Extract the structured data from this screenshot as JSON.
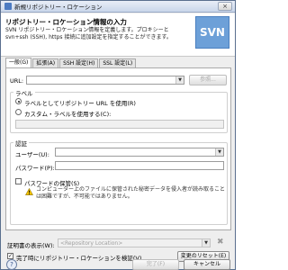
{
  "window": {
    "title": "新規リポジトリー・ロケーション",
    "close_glyph": "×"
  },
  "header": {
    "title": "リポジトリー・ロケーション情報の入力",
    "description": "SVN リポジトリー・ロケーション情報を定義します。プロキシーと svn+ssh (SSH), https 接続に追加設定を指定することができます。",
    "logo_text": "SVN"
  },
  "tabs": [
    {
      "label": "一般(G)"
    },
    {
      "label": "拡張(A)"
    },
    {
      "label": "SSH 設定(H)"
    },
    {
      "label": "SSL 設定(L)"
    }
  ],
  "general": {
    "url_label": "URL:",
    "url_value": "",
    "browse_button": "参照...",
    "label_group": "ラベル",
    "radio_use_url": "ラベルとしてリポジトリー URL を使用(R)",
    "radio_custom": "カスタム・ラベルを使用する(C):",
    "custom_label_value": "",
    "auth_group": "認証",
    "user_label": "ユーザー(U):",
    "user_value": "",
    "password_label": "パスワード(P):",
    "password_value": "",
    "save_password": "パスワードの保管(S)",
    "warning_note": "コンピューター上のファイルに保管された秘密データを侵入者が読み取ることは困難ですが、不可能ではありません。"
  },
  "footer": {
    "show_cert_label": "証明書の表示(W):",
    "cert_placeholder": "<Repository Location>",
    "validate_check": "完了時にリポジトリー・ロケーションを検証(V)",
    "reset_button": "変更のリセット(E)",
    "finish_button": "完了(F)",
    "cancel_button": "キャンセル"
  },
  "icons": {
    "help": "?",
    "clear": "✖",
    "combo_arrow": "▼",
    "check": "✓"
  }
}
